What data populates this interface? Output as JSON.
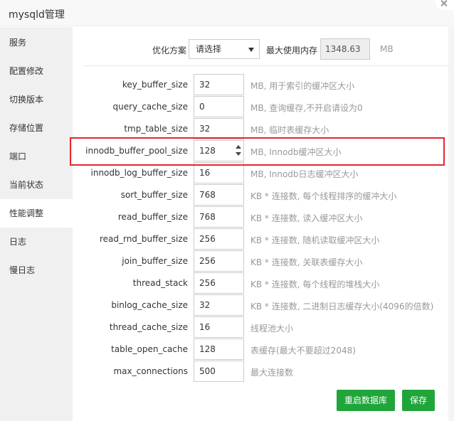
{
  "window": {
    "title": "mysqld管理"
  },
  "sidebar": {
    "items": [
      {
        "label": "服务"
      },
      {
        "label": "配置修改"
      },
      {
        "label": "切换版本"
      },
      {
        "label": "存储位置"
      },
      {
        "label": "端口"
      },
      {
        "label": "当前状态"
      },
      {
        "label": "性能调整",
        "active": true
      },
      {
        "label": "日志"
      },
      {
        "label": "慢日志"
      }
    ]
  },
  "optimization": {
    "label": "优化方案",
    "selected": "请选择",
    "max_memory_label": "最大使用内存",
    "max_memory_value": "1348.63",
    "max_memory_unit": "MB"
  },
  "params": [
    {
      "name": "key_buffer_size",
      "value": "32",
      "desc": "MB, 用于索引的缓冲区大小"
    },
    {
      "name": "query_cache_size",
      "value": "0",
      "desc": "MB, 查询缓存,不开启请设为0"
    },
    {
      "name": "tmp_table_size",
      "value": "32",
      "desc": "MB, 临时表缓存大小"
    },
    {
      "name": "innodb_buffer_pool_size",
      "value": "128",
      "desc": "MB, Innodb缓冲区大小",
      "highlighted": true
    },
    {
      "name": "innodb_log_buffer_size",
      "value": "16",
      "desc": "MB, Innodb日志缓冲区大小"
    },
    {
      "name": "sort_buffer_size",
      "value": "768",
      "desc": "KB * 连接数, 每个线程排序的缓冲大小"
    },
    {
      "name": "read_buffer_size",
      "value": "768",
      "desc": "KB * 连接数, 读入缓冲区大小"
    },
    {
      "name": "read_rnd_buffer_size",
      "value": "256",
      "desc": "KB * 连接数, 随机读取缓冲区大小"
    },
    {
      "name": "join_buffer_size",
      "value": "256",
      "desc": "KB * 连接数, 关联表缓存大小"
    },
    {
      "name": "thread_stack",
      "value": "256",
      "desc": "KB * 连接数, 每个线程的堆栈大小"
    },
    {
      "name": "binlog_cache_size",
      "value": "32",
      "desc": "KB * 连接数, 二进制日志缓存大小(4096的倍数)"
    },
    {
      "name": "thread_cache_size",
      "value": "16",
      "desc": "线程池大小"
    },
    {
      "name": "table_open_cache",
      "value": "128",
      "desc": "表缓存(最大不要超过2048)"
    },
    {
      "name": "max_connections",
      "value": "500",
      "desc": "最大连接数"
    }
  ],
  "buttons": {
    "restart": "重启数据库",
    "save": "保存"
  },
  "colors": {
    "accent": "#20a53a",
    "highlight": "#e6262e",
    "sidebar_bg": "#f0f0f0"
  },
  "icons": {
    "close": "close-icon",
    "dropdown": "chevron-down-icon",
    "spinner": "spinner-arrows-icon"
  }
}
